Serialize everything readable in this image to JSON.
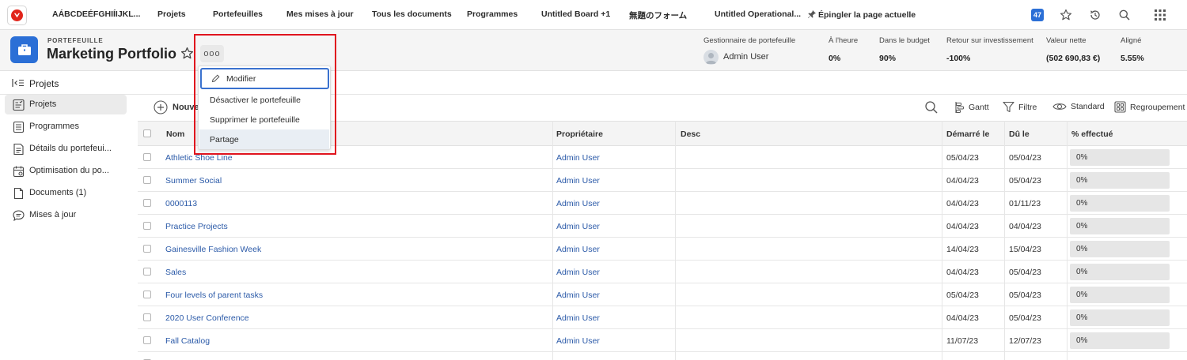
{
  "topnav": {
    "items": [
      "AÁBCDEÉFGHIÍIJKL...",
      "Projets",
      "Portefeuilles",
      "Mes mises à jour",
      "Tous les documents",
      "Programmes",
      "Untitled Board +1",
      "無題のフォーム",
      "Untitled Operational...",
      "Épingler la page actuelle"
    ],
    "badge": "47",
    "accent": "#2b6fd6",
    "brand": "#e1251b"
  },
  "header": {
    "kicker": "PORTEFEUILLE",
    "title": "Marketing Portfolio",
    "more_label": "ooo",
    "stats": [
      {
        "label": "Gestionnaire de portefeuille",
        "value": "Admin User"
      },
      {
        "label": "À l'heure",
        "value": "0%"
      },
      {
        "label": "Dans le budget",
        "value": "90%"
      },
      {
        "label": "Retour sur investissement",
        "value": "-100%"
      },
      {
        "label": "Valeur nette",
        "value": "(502 690,83 €)"
      },
      {
        "label": "Aligné",
        "value": "5.55%"
      }
    ]
  },
  "left_panel": {
    "title": "Projets",
    "items": [
      {
        "label": "Projets",
        "active": true
      },
      {
        "label": "Programmes"
      },
      {
        "label": "Détails du portefeui..."
      },
      {
        "label": "Optimisation du po..."
      },
      {
        "label": "Documents (1)"
      },
      {
        "label": "Mises à jour"
      }
    ]
  },
  "toolbar": {
    "new_label": "Nouveau",
    "gantt_label": "Gantt",
    "filter_label": "Filtre",
    "view_label": "Standard",
    "group_label": "Regroupement"
  },
  "table": {
    "headers": [
      "Nom",
      "Propriétaire",
      "Desc",
      "Démarré le",
      "Dû le",
      "% effectué"
    ],
    "rows": [
      {
        "name": "Athletic Shoe Line",
        "owner": "Admin User",
        "desc": "",
        "start": "05/04/23",
        "due": "05/04/23",
        "pct": "0%",
        "pct_value": 0
      },
      {
        "name": "Summer Social",
        "owner": "Admin User",
        "desc": "",
        "start": "04/04/23",
        "due": "05/04/23",
        "pct": "0%",
        "pct_value": 0
      },
      {
        "name": "0000113",
        "owner": "Admin User",
        "desc": "",
        "start": "04/04/23",
        "due": "01/11/23",
        "pct": "0%",
        "pct_value": 0
      },
      {
        "name": "Practice Projects",
        "owner": "Admin User",
        "desc": "",
        "start": "04/04/23",
        "due": "04/04/23",
        "pct": "0%",
        "pct_value": 0
      },
      {
        "name": "Gainesville Fashion Week",
        "owner": "Admin User",
        "desc": "",
        "start": "14/04/23",
        "due": "15/04/23",
        "pct": "0%",
        "pct_value": 0
      },
      {
        "name": "Sales",
        "owner": "Admin User",
        "desc": "",
        "start": "04/04/23",
        "due": "05/04/23",
        "pct": "0%",
        "pct_value": 0
      },
      {
        "name": "Four levels of parent tasks",
        "owner": "Admin User",
        "desc": "",
        "start": "05/04/23",
        "due": "05/04/23",
        "pct": "0%",
        "pct_value": 0
      },
      {
        "name": "2020 User Conference",
        "owner": "Admin User",
        "desc": "",
        "start": "04/04/23",
        "due": "05/04/23",
        "pct": "0%",
        "pct_value": 0
      },
      {
        "name": "Fall Catalog",
        "owner": "Admin User",
        "desc": "",
        "start": "11/07/23",
        "due": "12/07/23",
        "pct": "0%",
        "pct_value": 0
      }
    ]
  },
  "menu": {
    "items": [
      {
        "label": "Modifier",
        "state": "focused"
      },
      {
        "label": "Désactiver le portefeuille"
      },
      {
        "label": "Supprimer le portefeuille"
      },
      {
        "label": "Partage",
        "state": "hovered"
      }
    ],
    "highlight_color": "#e0141e"
  }
}
